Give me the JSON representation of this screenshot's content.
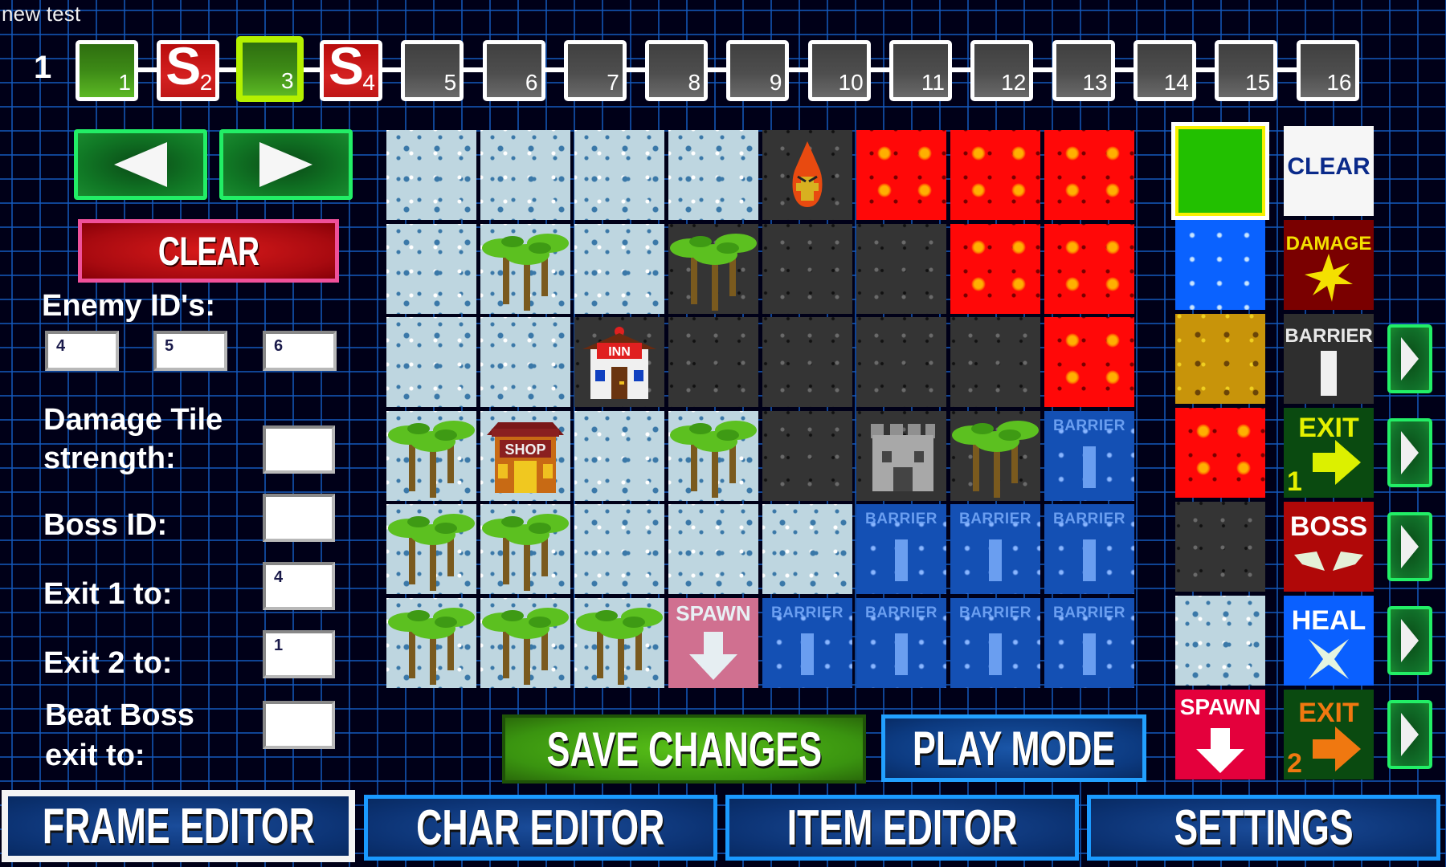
{
  "project": {
    "title": "new test"
  },
  "timeline": {
    "row_label": "1",
    "selected_frame": 3,
    "frames": [
      {
        "num": "1",
        "state": "filled",
        "glyph": ""
      },
      {
        "num": "2",
        "state": "start",
        "glyph": "S"
      },
      {
        "num": "3",
        "state": "filled",
        "glyph": ""
      },
      {
        "num": "4",
        "state": "start",
        "glyph": "S"
      },
      {
        "num": "5",
        "state": "empty",
        "glyph": ""
      },
      {
        "num": "6",
        "state": "empty",
        "glyph": ""
      },
      {
        "num": "7",
        "state": "empty",
        "glyph": ""
      },
      {
        "num": "8",
        "state": "empty",
        "glyph": ""
      },
      {
        "num": "9",
        "state": "empty",
        "glyph": ""
      },
      {
        "num": "10",
        "state": "empty",
        "glyph": ""
      },
      {
        "num": "11",
        "state": "empty",
        "glyph": ""
      },
      {
        "num": "12",
        "state": "empty",
        "glyph": ""
      },
      {
        "num": "13",
        "state": "empty",
        "glyph": ""
      },
      {
        "num": "14",
        "state": "empty",
        "glyph": ""
      },
      {
        "num": "15",
        "state": "empty",
        "glyph": ""
      },
      {
        "num": "16",
        "state": "empty",
        "glyph": ""
      }
    ]
  },
  "left_panel": {
    "prev_icon": "arrow-left-icon",
    "next_icon": "arrow-right-icon",
    "clear_label": "CLEAR",
    "enemy_ids_label": "Enemy ID's:",
    "enemy_ids": [
      "4",
      "5",
      "6"
    ],
    "damage_strength_label_1": "Damage Tile",
    "damage_strength_label_2": "strength:",
    "damage_strength_value": "",
    "boss_id_label": "Boss ID:",
    "boss_id_value": "",
    "exit1_label": "Exit 1 to:",
    "exit1_value": "4",
    "exit2_label": "Exit 2 to:",
    "exit2_value": "1",
    "beat_boss_label_1": "Beat Boss",
    "beat_boss_label_2": "exit to:",
    "beat_boss_value": ""
  },
  "map": {
    "rows": [
      [
        {
          "t": "snow"
        },
        {
          "t": "snow"
        },
        {
          "t": "snow"
        },
        {
          "t": "snow"
        },
        {
          "t": "rock",
          "o": "fire-enemy"
        },
        {
          "t": "lava"
        },
        {
          "t": "lava"
        },
        {
          "t": "lava"
        }
      ],
      [
        {
          "t": "snow"
        },
        {
          "t": "snow",
          "o": "palm-trees"
        },
        {
          "t": "snow"
        },
        {
          "t": "rock",
          "o": "palm-trees"
        },
        {
          "t": "rock"
        },
        {
          "t": "rock"
        },
        {
          "t": "lava"
        },
        {
          "t": "lava"
        }
      ],
      [
        {
          "t": "snow"
        },
        {
          "t": "snow"
        },
        {
          "t": "rock",
          "o": "inn"
        },
        {
          "t": "rock"
        },
        {
          "t": "rock"
        },
        {
          "t": "rock"
        },
        {
          "t": "rock"
        },
        {
          "t": "lava"
        }
      ],
      [
        {
          "t": "snow",
          "o": "palm-trees"
        },
        {
          "t": "snow",
          "o": "shop"
        },
        {
          "t": "snow"
        },
        {
          "t": "snow",
          "o": "palm-trees"
        },
        {
          "t": "rock"
        },
        {
          "t": "rock",
          "o": "castle"
        },
        {
          "t": "rock",
          "o": "palm-trees"
        },
        {
          "t": "water",
          "o": "barrier"
        }
      ],
      [
        {
          "t": "snow",
          "o": "palm-trees"
        },
        {
          "t": "snow",
          "o": "palm-trees"
        },
        {
          "t": "snow"
        },
        {
          "t": "snow"
        },
        {
          "t": "snow"
        },
        {
          "t": "water",
          "o": "barrier"
        },
        {
          "t": "water",
          "o": "barrier"
        },
        {
          "t": "water",
          "o": "barrier"
        }
      ],
      [
        {
          "t": "snow",
          "o": "palm-trees"
        },
        {
          "t": "snow",
          "o": "palm-trees"
        },
        {
          "t": "snow",
          "o": "palm-trees"
        },
        {
          "t": "spawn",
          "o": "spawn"
        },
        {
          "t": "water",
          "o": "barrier"
        },
        {
          "t": "water",
          "o": "barrier"
        },
        {
          "t": "water",
          "o": "barrier"
        },
        {
          "t": "water",
          "o": "barrier"
        }
      ]
    ],
    "labels": {
      "barrier": "BARRIER",
      "spawn": "SPAWN",
      "inn": "INN",
      "shop": "SHOP"
    }
  },
  "palette": {
    "terrain": [
      {
        "id": "grass",
        "selected": true
      },
      {
        "id": "blue",
        "selected": false
      },
      {
        "id": "sand",
        "selected": false
      },
      {
        "id": "lava",
        "selected": false
      },
      {
        "id": "rock",
        "selected": false
      },
      {
        "id": "snow",
        "selected": false
      },
      {
        "id": "spawn",
        "selected": false,
        "label": "SPAWN"
      }
    ],
    "special": [
      {
        "id": "clear",
        "label": "CLEAR",
        "has_arrow": false
      },
      {
        "id": "damage",
        "label": "DAMAGE",
        "has_arrow": false
      },
      {
        "id": "barrier",
        "label": "BARRIER",
        "has_arrow": true
      },
      {
        "id": "exit1",
        "label": "EXIT",
        "sub": "1",
        "has_arrow": true
      },
      {
        "id": "boss",
        "label": "BOSS",
        "has_arrow": true
      },
      {
        "id": "heal",
        "label": "HEAL",
        "has_arrow": true
      },
      {
        "id": "exit2",
        "label": "EXIT",
        "sub": "2",
        "has_arrow": true
      }
    ]
  },
  "actions": {
    "save_label": "SAVE CHANGES",
    "play_label": "PLAY MODE"
  },
  "tabs": [
    {
      "label": "FRAME EDITOR",
      "active": true
    },
    {
      "label": "CHAR EDITOR",
      "active": false
    },
    {
      "label": "ITEM EDITOR",
      "active": false
    },
    {
      "label": "SETTINGS",
      "active": false
    }
  ],
  "colors": {
    "nav_green": "#22ee66",
    "clear_pink": "#f0509a",
    "selected_frame": "#b4f000",
    "tab_border": "#1a9aff",
    "lava": "#ff0808",
    "snow": "#bed6e0"
  }
}
